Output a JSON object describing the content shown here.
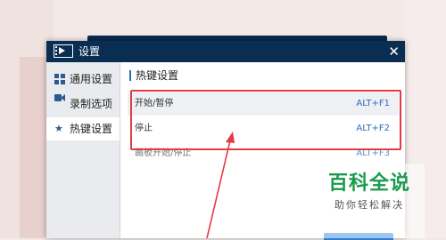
{
  "dialog": {
    "title": "设置",
    "close_glyph": "✕"
  },
  "sidebar": {
    "items": [
      {
        "label": "通用设置",
        "icon": "grid-icon"
      },
      {
        "label": "录制选项",
        "icon": "video-camera-icon"
      },
      {
        "label": "热键设置",
        "icon": "star-icon",
        "active": true
      }
    ]
  },
  "content": {
    "section_title": "热键设置",
    "hotkeys": [
      {
        "label": "开始/暂停",
        "key": "ALT+F1"
      },
      {
        "label": "停止",
        "key": "ALT+F2"
      },
      {
        "label": "画板开始/停止",
        "key": "ALT+F3"
      }
    ]
  },
  "annotation": {
    "box_color": "#e23b42",
    "arrow_color": "#e23b42"
  },
  "watermark": {
    "main": "百科全说",
    "sub": "助你轻松解决",
    "color": "#1a9b4d"
  },
  "colors": {
    "titlebar": "#0a2d52",
    "accent": "#2e6db8"
  }
}
